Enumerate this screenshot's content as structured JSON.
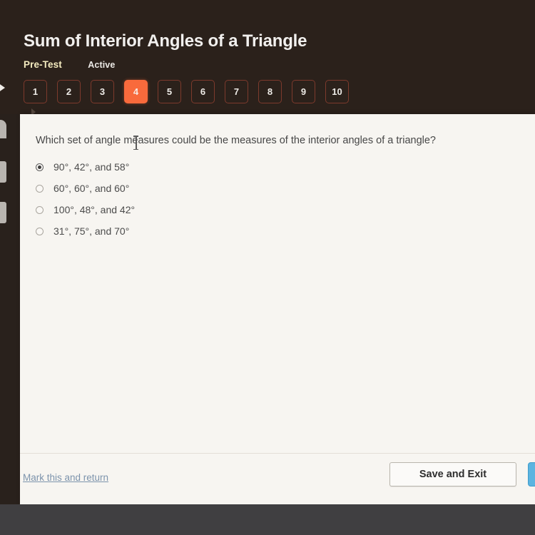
{
  "header": {
    "title": "Sum of Interior Angles of a Triangle",
    "test_type": "Pre-Test",
    "status": "Active",
    "accent_color": "#f96a3c",
    "tab_border_color": "#7d3a2c",
    "background_color": "#2b211b"
  },
  "tabs": [
    {
      "label": "1",
      "current": false
    },
    {
      "label": "2",
      "current": false
    },
    {
      "label": "3",
      "current": false
    },
    {
      "label": "4",
      "current": true
    },
    {
      "label": "5",
      "current": false
    },
    {
      "label": "6",
      "current": false
    },
    {
      "label": "7",
      "current": false
    },
    {
      "label": "8",
      "current": false
    },
    {
      "label": "9",
      "current": false
    },
    {
      "label": "10",
      "current": false
    }
  ],
  "question": {
    "prompt": "Which set of angle measures could be the measures of the interior angles of a triangle?",
    "options": [
      {
        "label": "90°, 42°, and 58°",
        "selected": true
      },
      {
        "label": "60°, 60°, and 60°",
        "selected": false
      },
      {
        "label": "100°, 48°, and 42°",
        "selected": false
      },
      {
        "label": "31°, 75°, and 70°",
        "selected": false
      }
    ]
  },
  "footer": {
    "mark_link": "Mark this and return",
    "save_exit_label": "Save and Exit",
    "next_button_color": "#5cb4e0",
    "link_color": "#7c93ac"
  },
  "panel": {
    "background_color": "#f7f5f1"
  }
}
